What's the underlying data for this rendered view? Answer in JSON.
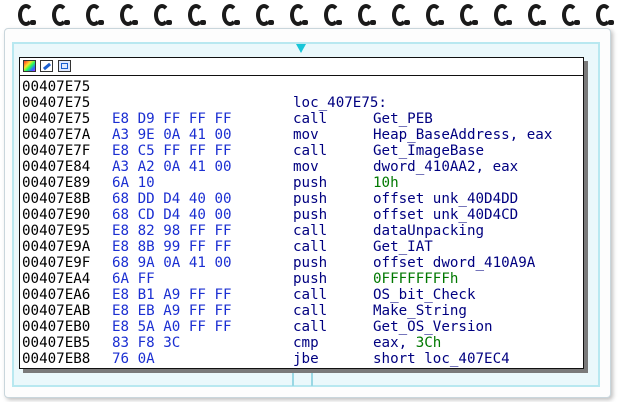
{
  "node": {
    "rows": [
      {
        "addr": "00407E75",
        "bytes": "",
        "mnemonic": "",
        "operand": "",
        "label": "",
        "operand_type": ""
      },
      {
        "addr": "00407E75",
        "bytes": "",
        "mnemonic": "",
        "operand": "",
        "label": "loc_407E75:",
        "operand_type": ""
      },
      {
        "addr": "00407E75",
        "bytes": "E8 D9 FF FF FF",
        "mnemonic": "call",
        "operand": "Get_PEB",
        "label": "",
        "operand_type": "sym"
      },
      {
        "addr": "00407E7A",
        "bytes": "A3 9E 0A 41 00",
        "mnemonic": "mov",
        "operand": "Heap_BaseAddress, eax",
        "label": "",
        "operand_type": "sym"
      },
      {
        "addr": "00407E7F",
        "bytes": "E8 C5 FF FF FF",
        "mnemonic": "call",
        "operand": "Get_ImageBase",
        "label": "",
        "operand_type": "sym"
      },
      {
        "addr": "00407E84",
        "bytes": "A3 A2 0A 41 00",
        "mnemonic": "mov",
        "operand": "dword_410AA2, eax",
        "label": "",
        "operand_type": "sym"
      },
      {
        "addr": "00407E89",
        "bytes": "6A 10",
        "mnemonic": "push",
        "operand": "10h",
        "label": "",
        "operand_type": "num"
      },
      {
        "addr": "00407E8B",
        "bytes": "68 DD D4 40 00",
        "mnemonic": "push",
        "operand": "offset unk_40D4DD",
        "label": "",
        "operand_type": "sym"
      },
      {
        "addr": "00407E90",
        "bytes": "68 CD D4 40 00",
        "mnemonic": "push",
        "operand": "offset unk_40D4CD",
        "label": "",
        "operand_type": "sym"
      },
      {
        "addr": "00407E95",
        "bytes": "E8 82 98 FF FF",
        "mnemonic": "call",
        "operand": "dataUnpacking",
        "label": "",
        "operand_type": "sym"
      },
      {
        "addr": "00407E9A",
        "bytes": "E8 8B 99 FF FF",
        "mnemonic": "call",
        "operand": "Get_IAT",
        "label": "",
        "operand_type": "sym"
      },
      {
        "addr": "00407E9F",
        "bytes": "68 9A 0A 41 00",
        "mnemonic": "push",
        "operand": "offset dword_410A9A",
        "label": "",
        "operand_type": "sym"
      },
      {
        "addr": "00407EA4",
        "bytes": "6A FF",
        "mnemonic": "push",
        "operand": "0FFFFFFFFh",
        "label": "",
        "operand_type": "num"
      },
      {
        "addr": "00407EA6",
        "bytes": "E8 B1 A9 FF FF",
        "mnemonic": "call",
        "operand": "OS_bit_Check",
        "label": "",
        "operand_type": "sym"
      },
      {
        "addr": "00407EAB",
        "bytes": "E8 EB A9 FF FF",
        "mnemonic": "call",
        "operand": "Make_String",
        "label": "",
        "operand_type": "sym"
      },
      {
        "addr": "00407EB0",
        "bytes": "E8 5A A0 FF FF",
        "mnemonic": "call",
        "operand": "Get_OS_Version",
        "label": "",
        "operand_type": "sym"
      },
      {
        "addr": "00407EB5",
        "bytes": "83 F8 3C",
        "mnemonic": "cmp",
        "operand": "eax, 3Ch",
        "label": "",
        "operand_type": "mixed"
      },
      {
        "addr": "00407EB8",
        "bytes": "76 0A",
        "mnemonic": "jbe",
        "operand": "short loc_407EC4",
        "label": "",
        "operand_type": "sym"
      }
    ]
  },
  "header_icons": [
    "color-palette-icon",
    "edit-icon",
    "graph-overview-icon"
  ],
  "colors": {
    "address": "#000000",
    "bytes": "#1b2fd2",
    "mnemonic": "#000080",
    "number": "#007800",
    "accent": "#19c6d8"
  }
}
